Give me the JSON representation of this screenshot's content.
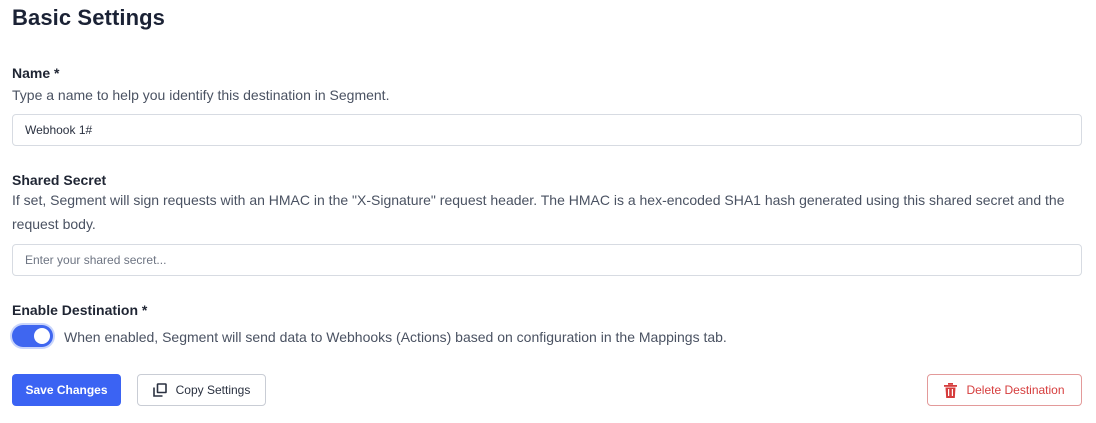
{
  "page": {
    "title": "Basic Settings"
  },
  "name_field": {
    "label": "Name *",
    "help": "Type a name to help you identify this destination in Segment.",
    "value": "Webhook 1#",
    "placeholder": ""
  },
  "secret_field": {
    "label": "Shared Secret",
    "help": "If set, Segment will sign requests with an HMAC in the \"X-Signature\" request header. The HMAC is a hex-encoded SHA1 hash generated using this shared secret and the request body.",
    "value": "",
    "placeholder": "Enter your shared secret..."
  },
  "enable_field": {
    "label": "Enable Destination *",
    "toggle_on": true,
    "description": "When enabled, Segment will send data to Webhooks (Actions) based on configuration in the Mappings tab."
  },
  "actions": {
    "save_label": "Save Changes",
    "copy_label": "Copy Settings",
    "copy_icon": "copy-icon",
    "delete_label": "Delete Destination",
    "delete_icon": "trash-icon"
  },
  "colors": {
    "primary": "#3b63f3",
    "danger": "#d63d3d",
    "toggle_on": "#3f66f0"
  }
}
